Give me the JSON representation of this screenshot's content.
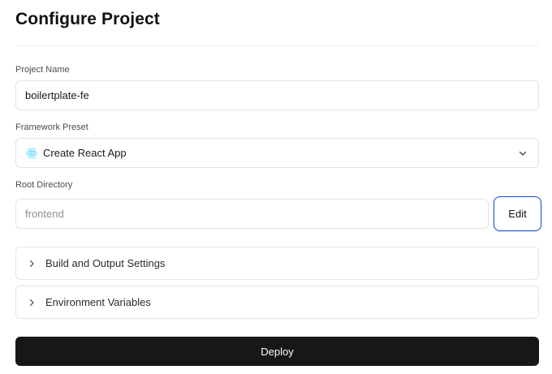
{
  "page": {
    "title": "Configure Project"
  },
  "project_name": {
    "label": "Project Name",
    "value": "boilertplate-fe"
  },
  "framework": {
    "label": "Framework Preset",
    "selected": "Create React App",
    "icon": "react-icon",
    "accent": "#61dafb"
  },
  "root_directory": {
    "label": "Root Directory",
    "value": "frontend",
    "edit_label": "Edit"
  },
  "sections": [
    {
      "label": "Build and Output Settings"
    },
    {
      "label": "Environment Variables"
    }
  ],
  "deploy": {
    "label": "Deploy"
  },
  "colors": {
    "focus_ring": "#1d4ed8",
    "deploy_bg": "#171717"
  }
}
